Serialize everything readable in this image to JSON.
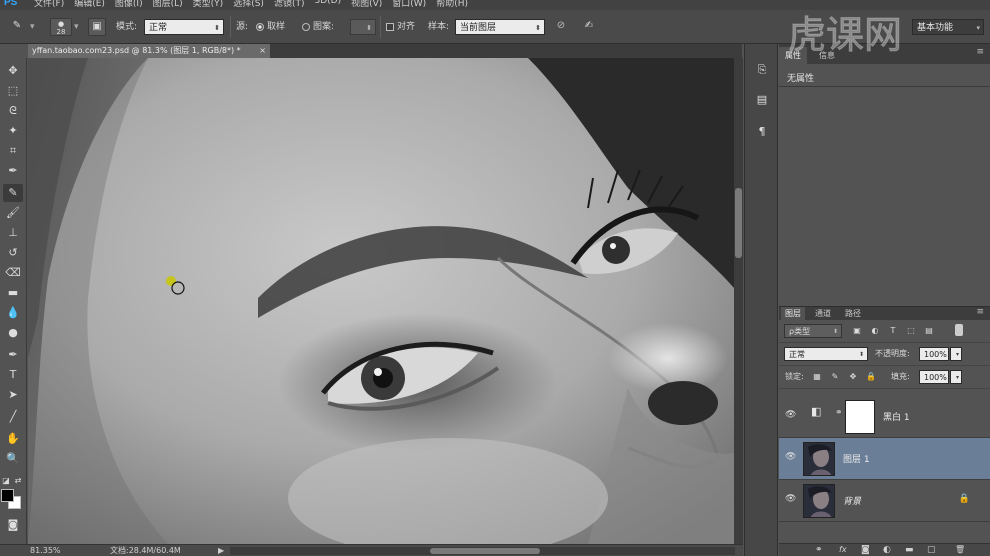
{
  "app": {
    "logo": "PS",
    "menu": [
      "文件(F)",
      "编辑(E)",
      "图像(I)",
      "图层(L)",
      "类型(Y)",
      "选择(S)",
      "滤镜(T)",
      "3D(D)",
      "视图(V)",
      "窗口(W)",
      "帮助(H)"
    ]
  },
  "options": {
    "brush_size": "28",
    "mode_label": "模式:",
    "mode_value": "正常",
    "source_label": "源:",
    "sampled_label": "取样",
    "pattern_label": "图案:",
    "aligned_label": "对齐",
    "sample_label": "样本:",
    "sample_value": "当前图层",
    "workspace": "基本功能"
  },
  "document": {
    "tab_title": "yffan.taobao.com23.psd @ 81.3% (图层 1, RGB/8*) *",
    "close": "×"
  },
  "status": {
    "zoom": "81.35%",
    "doc_size": "文档:28.4M/60.4M",
    "play": "▶"
  },
  "properties": {
    "tab1": "属性",
    "tab2": "信息",
    "title": "无属性"
  },
  "layers_panel": {
    "tabs": [
      "图层",
      "通道",
      "路径"
    ],
    "filter_kind": "ρ类型",
    "blend_mode": "正常",
    "opacity_label": "不透明度:",
    "opacity_value": "100%",
    "lock_label": "锁定:",
    "fill_label": "填充:",
    "fill_value": "100%",
    "layers": [
      {
        "name": "黑白 1",
        "type": "adjustment"
      },
      {
        "name": "图层 1",
        "type": "pixel",
        "selected": true
      },
      {
        "name": "背景",
        "type": "background",
        "locked": true
      }
    ],
    "footer_icons": [
      "link-icon",
      "fx-icon",
      "mask-icon",
      "adjustment-icon",
      "folder-icon",
      "new-layer-icon",
      "trash-icon"
    ],
    "footer_glyphs": [
      "⚭",
      "fx",
      "◙",
      "◐",
      "▬",
      "▢",
      "🗑"
    ]
  },
  "colors": {
    "foreground": "#000000",
    "background": "#ffffff",
    "selected_layer": "#6b7e97",
    "ps_blue": "#31a8ff"
  },
  "watermark": "虎课网"
}
